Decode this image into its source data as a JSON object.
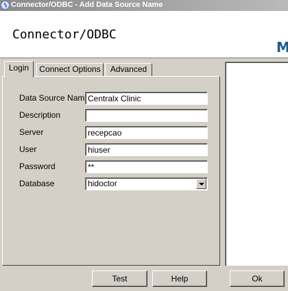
{
  "window": {
    "title": "Connector/ODBC - Add Data Source Name",
    "icon": "odbc-app-icon"
  },
  "banner": {
    "heading": "Connector/ODBC",
    "logo_fragment": "M",
    "logo_color": "#1d5b8f"
  },
  "tabs": [
    {
      "label": "Login",
      "active": true
    },
    {
      "label": "Connect Options",
      "active": false
    },
    {
      "label": "Advanced",
      "active": false
    }
  ],
  "form": {
    "data_source_name": {
      "label": "Data Source Name",
      "value": "Centralx Clinic"
    },
    "description": {
      "label": "Description",
      "value": ""
    },
    "server": {
      "label": "Server",
      "value": "recepcao"
    },
    "user": {
      "label": "User",
      "value": "hiuser"
    },
    "password": {
      "label": "Password",
      "value": "**"
    },
    "database": {
      "label": "Database",
      "value": "hidoctor"
    }
  },
  "buttons": {
    "test": "Test",
    "help": "Help",
    "ok": "Ok"
  }
}
